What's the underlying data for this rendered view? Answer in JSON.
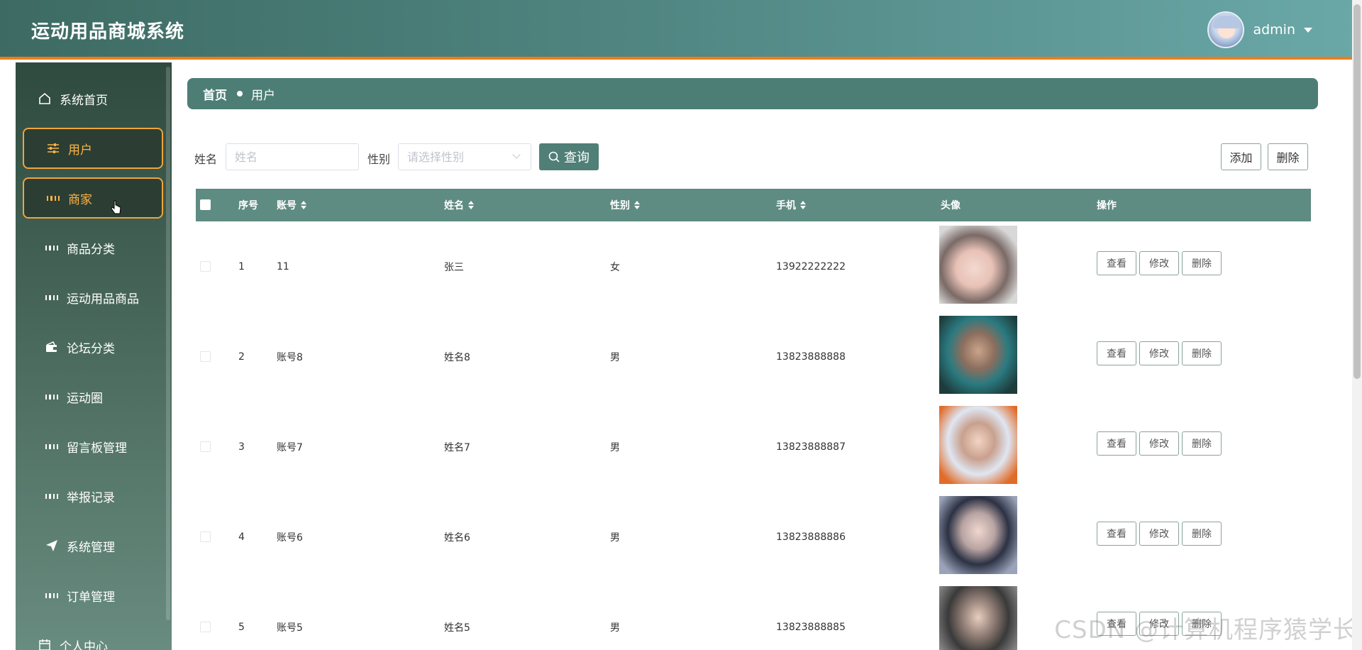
{
  "app": {
    "title": "运动用品商城系统"
  },
  "user": {
    "name": "admin"
  },
  "sidebar": {
    "items": [
      {
        "label": "系统首页",
        "icon": "home-icon"
      },
      {
        "label": "用户",
        "icon": "sliders-icon"
      },
      {
        "label": "商家",
        "icon": "grid-icon"
      },
      {
        "label": "商品分类",
        "icon": "grid-icon"
      },
      {
        "label": "运动用品商品",
        "icon": "grid-icon"
      },
      {
        "label": "论坛分类",
        "icon": "wallet-icon"
      },
      {
        "label": "运动圈",
        "icon": "grid-icon"
      },
      {
        "label": "留言板管理",
        "icon": "grid-icon"
      },
      {
        "label": "举报记录",
        "icon": "grid-icon"
      },
      {
        "label": "系统管理",
        "icon": "paper-plane-icon"
      },
      {
        "label": "订单管理",
        "icon": "grid-icon"
      },
      {
        "label": "个人中心",
        "icon": "calendar-icon"
      }
    ]
  },
  "breadcrumb": {
    "home": "首页",
    "current": "用户"
  },
  "filter": {
    "name_label": "姓名",
    "name_placeholder": "姓名",
    "gender_label": "性别",
    "gender_placeholder": "请选择性别",
    "query_label": "查询"
  },
  "toolbar": {
    "add_label": "添加",
    "delete_label": "删除"
  },
  "table": {
    "columns": [
      "序号",
      "账号",
      "姓名",
      "性别",
      "手机",
      "头像",
      "操作"
    ],
    "actions": {
      "view": "查看",
      "edit": "修改",
      "delete": "删除"
    },
    "rows": [
      {
        "index": "1",
        "account": "11",
        "name": "张三",
        "gender": "女",
        "phone": "13922222222"
      },
      {
        "index": "2",
        "account": "账号8",
        "name": "姓名8",
        "gender": "男",
        "phone": "13823888888"
      },
      {
        "index": "3",
        "account": "账号7",
        "name": "姓名7",
        "gender": "男",
        "phone": "13823888887"
      },
      {
        "index": "4",
        "account": "账号6",
        "name": "姓名6",
        "gender": "男",
        "phone": "13823888886"
      },
      {
        "index": "5",
        "account": "账号5",
        "name": "姓名5",
        "gender": "男",
        "phone": "13823888885"
      }
    ]
  },
  "colors": {
    "header": "#4f8480",
    "accent": "#f07c16",
    "active_menu": "#f0a43a",
    "table_header": "#5e8b82"
  },
  "watermark": "CSDN @计算机程序猿学长"
}
